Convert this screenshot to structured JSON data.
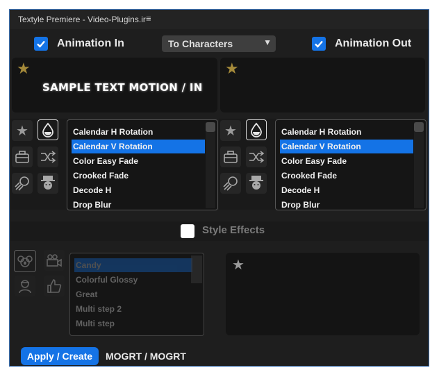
{
  "window": {
    "title": "Textyle Premiere - Video-Plugins.ir",
    "menu_glyph": "≡"
  },
  "toolbar": {
    "animation_in": {
      "label": "Animation In",
      "checked": true
    },
    "mode_select": {
      "value": "To Characters"
    },
    "animation_out": {
      "label": "Animation Out",
      "checked": true
    }
  },
  "preview_in": {
    "sample_text": "SAMPLE TEXT MOTION / IN"
  },
  "preview_out": {
    "sample_text": ""
  },
  "in_list": {
    "items": [
      "Calendar H Rotation",
      "Calendar V Rotation",
      "Color Easy Fade",
      "Crooked Fade",
      "Decode H",
      "Drop Blur"
    ],
    "selected": "Calendar V Rotation"
  },
  "out_list": {
    "items": [
      "Calendar H Rotation",
      "Calendar V Rotation",
      "Color Easy Fade",
      "Crooked Fade",
      "Decode H",
      "Drop Blur"
    ],
    "selected": "Calendar V Rotation"
  },
  "style_effects": {
    "label": "Style Effects",
    "checked": false,
    "items": [
      "Candy",
      "Colorful Glossy",
      "Great",
      "Multi step 2",
      "Multi step"
    ],
    "selected": "Candy"
  },
  "footer": {
    "apply_label": "Apply / Create",
    "mogrt_label": "MOGRT / MOGRT"
  },
  "colors": {
    "accent": "#1473e6",
    "panel_bg": "#1e1e1e",
    "star_gold": "#a58a3a"
  }
}
